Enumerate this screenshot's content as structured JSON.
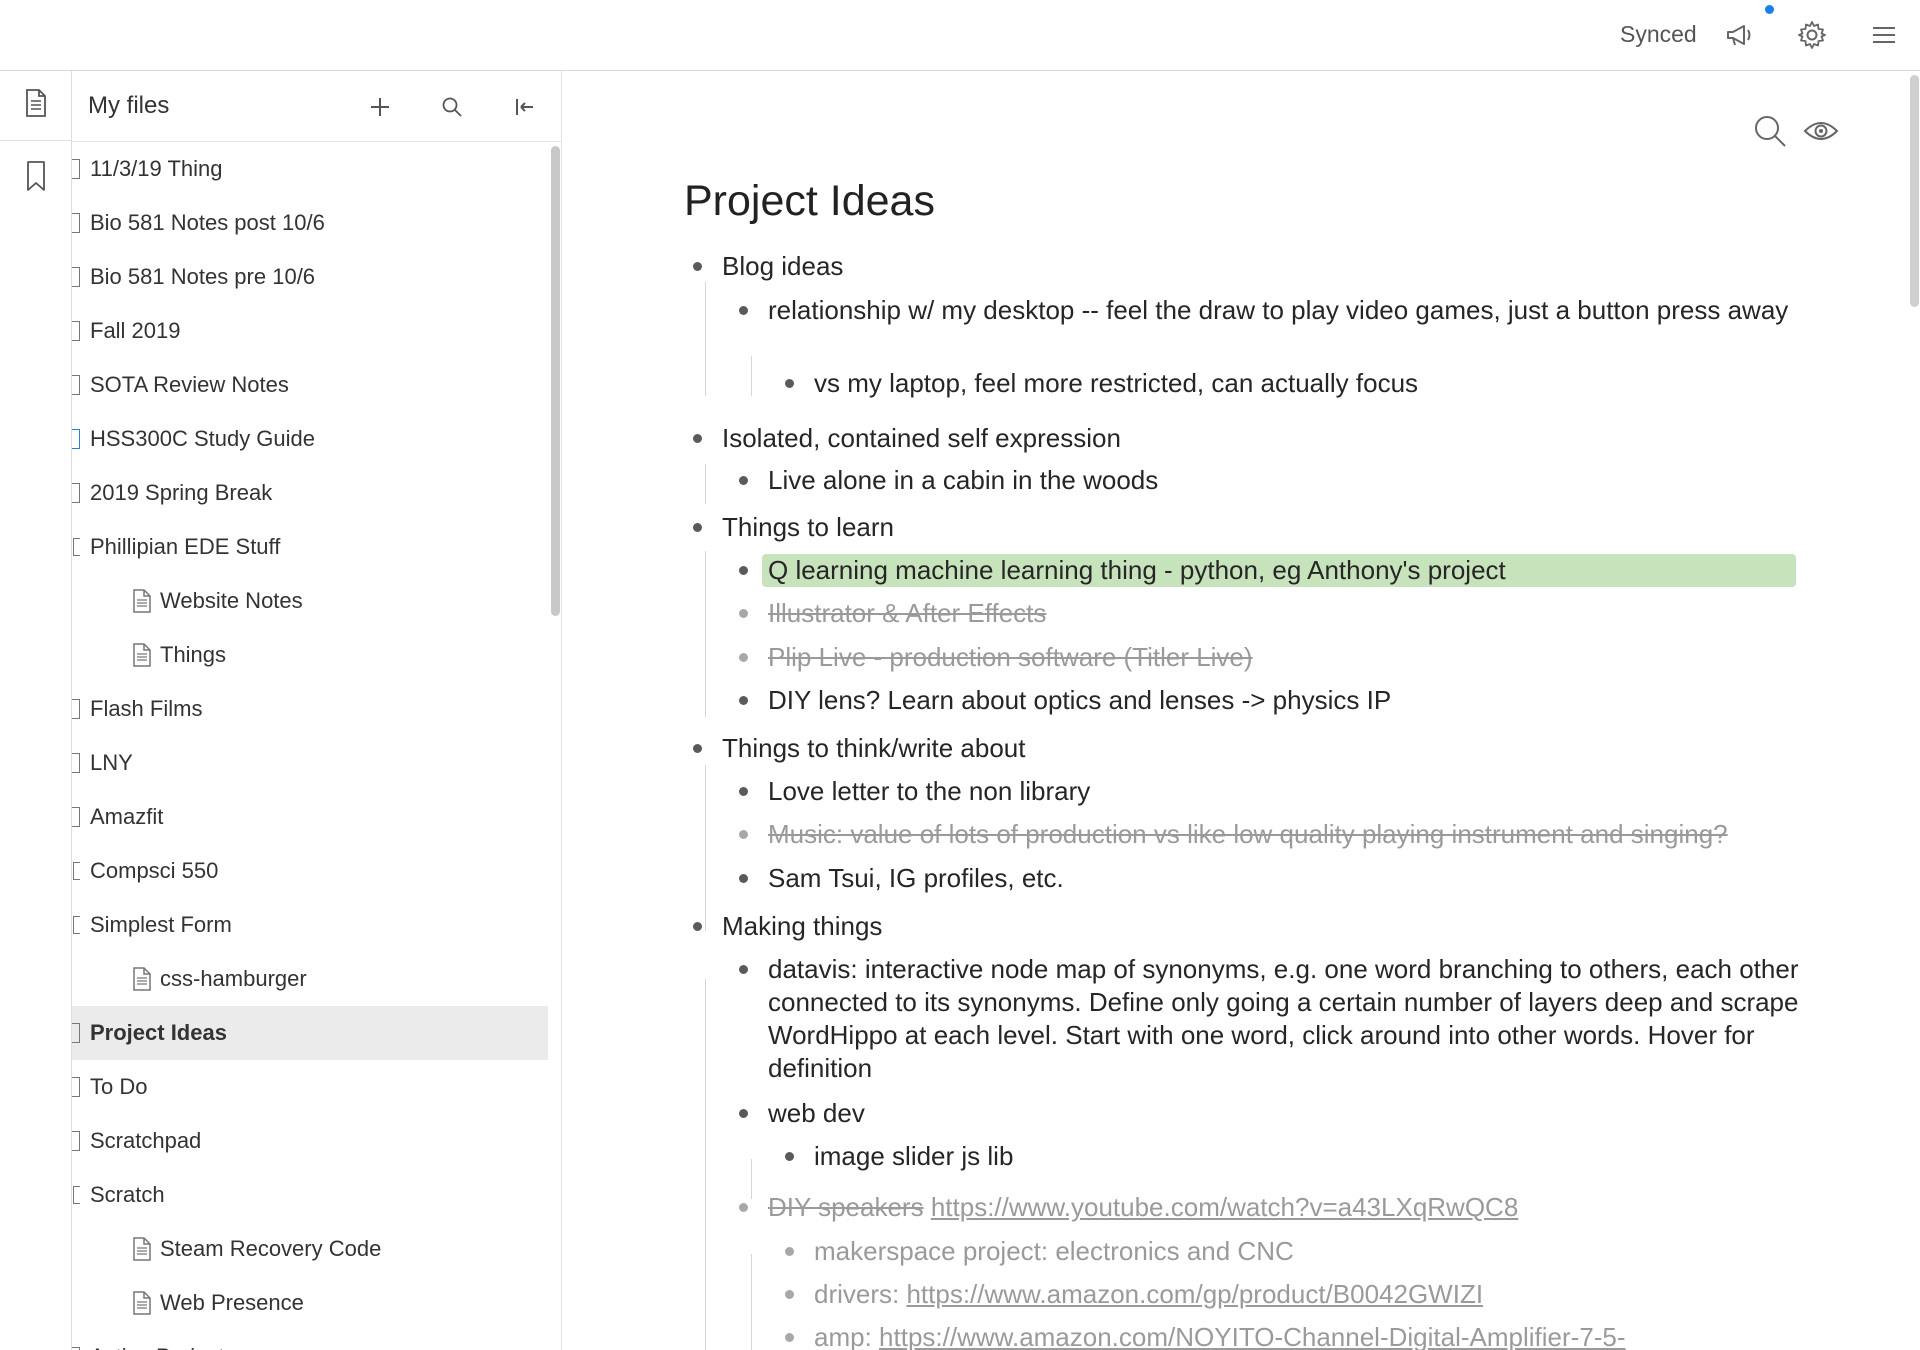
{
  "topbar": {
    "sync_status": "Synced",
    "icons": [
      "megaphone-icon",
      "gear-icon",
      "hamburger-menu-icon"
    ],
    "notification_dot_color": "#1a7fe8"
  },
  "iconrail": {
    "items": [
      "document-icon",
      "bookmark-icon"
    ]
  },
  "sidebar": {
    "title": "My files",
    "header_icons": [
      "plus-icon",
      "search-icon",
      "collapse-sidebar-icon"
    ],
    "files": [
      {
        "label": "11/3/19 Thing",
        "type": "doc"
      },
      {
        "label": "Bio 581 Notes post 10/6",
        "type": "doc"
      },
      {
        "label": "Bio 581 Notes pre 10/6",
        "type": "doc"
      },
      {
        "label": "Fall 2019",
        "type": "doc"
      },
      {
        "label": "SOTA Review Notes",
        "type": "doc"
      },
      {
        "label": "HSS300C Study Guide",
        "type": "doc-blue"
      },
      {
        "label": "2019 Spring Break",
        "type": "doc"
      },
      {
        "label": "Phillipian EDE Stuff",
        "type": "folder"
      },
      {
        "label": "Website Notes",
        "type": "child"
      },
      {
        "label": "Things",
        "type": "child"
      },
      {
        "label": "Flash Films",
        "type": "doc"
      },
      {
        "label": "LNY",
        "type": "doc"
      },
      {
        "label": "Amazfit",
        "type": "doc"
      },
      {
        "label": "Compsci 550",
        "type": "folder"
      },
      {
        "label": "Simplest Form",
        "type": "folder"
      },
      {
        "label": "css-hamburger",
        "type": "child"
      },
      {
        "label": "Project Ideas",
        "type": "doc",
        "selected": true
      },
      {
        "label": "To Do",
        "type": "doc"
      },
      {
        "label": "Scratchpad",
        "type": "doc"
      },
      {
        "label": "Scratch",
        "type": "folder"
      },
      {
        "label": "Steam Recovery Code",
        "type": "child"
      },
      {
        "label": "Web Presence",
        "type": "child"
      },
      {
        "label": "Active Projects",
        "type": "doc"
      }
    ]
  },
  "document": {
    "title": "Project Ideas",
    "highlight_color": "#c7e3bc",
    "outline": {
      "blog": "Blog ideas",
      "blog_1": "relationship w/ my desktop -- feel the draw to play video games, just a button press away",
      "blog_1_1": "vs my laptop, feel more restricted, can actually focus",
      "isolated": "Isolated, contained self expression",
      "isolated_1": "Live alone in a cabin in the woods",
      "learn": "Things to learn",
      "learn_1": "Q learning machine learning thing - python, eg Anthony's project",
      "learn_2": "Illustrator & After Effects",
      "learn_3": "Plip Live - production software (Titler Live)",
      "learn_4": "DIY lens? Learn about optics and lenses -> physics IP",
      "think": "Things to think/write about",
      "think_1": "Love letter to the non library",
      "think_2": "Music: value of lots of production vs like low quality playing instrument and singing?",
      "think_3": "Sam Tsui, IG profiles, etc.",
      "making": "Making things",
      "making_1": "datavis: interactive node map of synonyms, e.g. one word branching to others, each other connected to its synonyms. Define only going a certain number of layers deep and scrape WordHippo at each level. Start with one word, click around into other words. Hover for definition",
      "making_2": "web dev",
      "making_2_1": "image slider js lib",
      "making_3_text": "DIY speakers",
      "making_3_link": "https://www.youtube.com/watch?v=a43LXqRwQC8",
      "making_3_1": "makerspace project: electronics and CNC",
      "making_3_2_text": "drivers: ",
      "making_3_2_link": "https://www.amazon.com/gp/product/B0042GWIZI",
      "making_3_3_text": "amp: ",
      "making_3_3_link": "https://www.amazon.com/NOYITO-Channel-Digital-Amplifier-7-5-"
    }
  }
}
